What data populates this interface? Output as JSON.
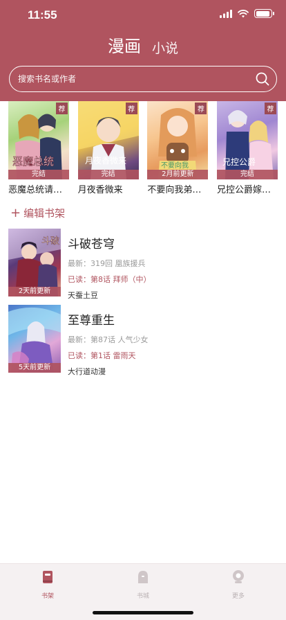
{
  "status_bar": {
    "time": "11:55"
  },
  "header": {
    "tabs": [
      {
        "label": "漫画",
        "active": true
      },
      {
        "label": "小说",
        "active": false
      }
    ],
    "search": {
      "placeholder": "搜索书名或作者"
    },
    "colors": {
      "accent": "#b0545f"
    }
  },
  "recommend": {
    "badge": "荐",
    "items": [
      {
        "title": "恶魔总统请…",
        "status": "完结"
      },
      {
        "title": "月夜香微来",
        "status": "完结"
      },
      {
        "title": "不要向我弟…",
        "status": "2月前更新"
      },
      {
        "title": "兄控公爵嫁…",
        "status": "完结"
      }
    ]
  },
  "edit_shelf": {
    "plus": "+",
    "label": "编辑书架"
  },
  "shelf": [
    {
      "title": "斗破苍穹",
      "latest": "最新：319回 凰族援兵",
      "read": "已读：第8话 拜师（中）",
      "author": "天蚕土豆",
      "update": "2天前更新"
    },
    {
      "title": "至尊重生",
      "latest": "最新：第87话 人气少女",
      "read": "已读：第1话 雷雨天",
      "author": "大行道动漫",
      "update": "5天前更新"
    }
  ],
  "tabbar": {
    "items": [
      {
        "label": "书架",
        "icon": "bookshelf-icon",
        "active": true
      },
      {
        "label": "书城",
        "icon": "bookstore-icon",
        "active": false
      },
      {
        "label": "更多",
        "icon": "more-icon",
        "active": false
      }
    ],
    "active_color": "#b0545f",
    "inactive_color": "#b9b1b3"
  }
}
